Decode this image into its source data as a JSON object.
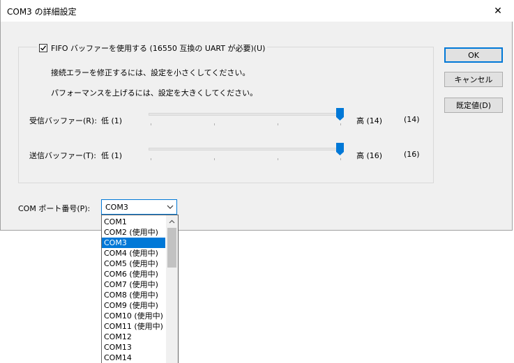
{
  "window": {
    "title": "COM3 の詳細設定",
    "close_glyph": "✕"
  },
  "fifo": {
    "checked": true,
    "label": "FIFO バッファーを使用する (16550 互換の UART が必要)(U)"
  },
  "hints": {
    "line1": "接続エラーを修正するには、設定を小さくしてください。",
    "line2": "パフォーマンスを上げるには、設定を大きくしてください。"
  },
  "receive": {
    "label": "受信バッファー(R):",
    "low": "低 (1)",
    "high": "高 (14)",
    "value_text": "(14)",
    "min": 1,
    "max": 14,
    "value": 14
  },
  "transmit": {
    "label": "送信バッファー(T):",
    "low": "低 (1)",
    "high": "高 (16)",
    "value_text": "(16)",
    "min": 1,
    "max": 16,
    "value": 16
  },
  "buttons": {
    "ok": "OK",
    "cancel": "キャンセル",
    "defaults": "既定値(D)"
  },
  "com_port": {
    "label": "COM ポート番号(P):",
    "selected": "COM3",
    "options": [
      "COM1",
      "COM2 (使用中)",
      "COM3",
      "COM4 (使用中)",
      "COM5 (使用中)",
      "COM6 (使用中)",
      "COM7 (使用中)",
      "COM8 (使用中)",
      "COM9 (使用中)",
      "COM10 (使用中)",
      "COM11 (使用中)",
      "COM12",
      "COM13",
      "COM14"
    ],
    "selected_index": 2
  },
  "colors": {
    "accent": "#0078d7",
    "dialog_bg": "#f0f0f0"
  }
}
